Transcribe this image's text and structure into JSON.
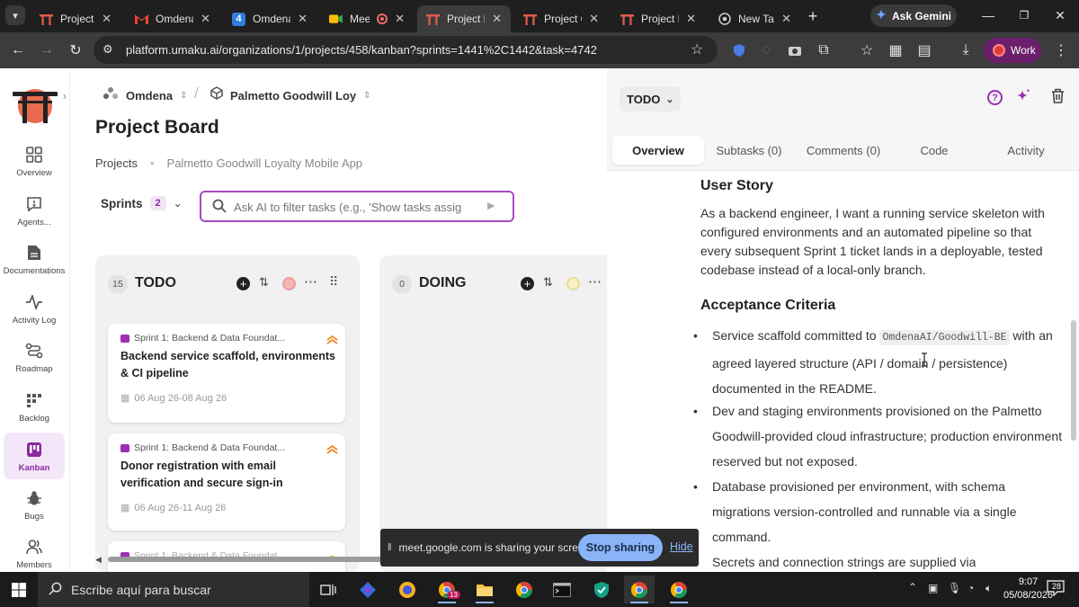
{
  "browser": {
    "tabs": [
      {
        "title": "Project B",
        "icon": "umaku-icon",
        "active": false
      },
      {
        "title": "Omdena",
        "icon": "gmail-icon",
        "active": false
      },
      {
        "title": "Omdena",
        "icon": "app-4-icon",
        "active": false
      },
      {
        "title": "Meet",
        "icon": "meet-icon",
        "active": false
      },
      {
        "title": "Project B",
        "icon": "umaku-icon",
        "active": true
      },
      {
        "title": "Project O",
        "icon": "umaku-icon",
        "active": false
      },
      {
        "title": "Project B",
        "icon": "umaku-icon",
        "active": false
      },
      {
        "title": "New Tab",
        "icon": "chrome-icon",
        "active": false
      }
    ],
    "gemini_label": "Ask Gemini",
    "url": "platform.umaku.ai/organizations/1/projects/458/kanban?sprints=1441%2C1442&task=4742",
    "profile_label": "Work"
  },
  "sidebar": {
    "items": [
      {
        "label": "Overview",
        "icon": "overview-icon",
        "active": false
      },
      {
        "label": "Agents...",
        "icon": "agents-icon",
        "active": false
      },
      {
        "label": "Documentations",
        "icon": "document-icon",
        "active": false
      },
      {
        "label": "Activity Log",
        "icon": "activity-icon",
        "active": false
      },
      {
        "label": "Roadmap",
        "icon": "roadmap-icon",
        "active": false
      },
      {
        "label": "Backlog",
        "icon": "backlog-icon",
        "active": false
      },
      {
        "label": "Kanban",
        "icon": "kanban-icon",
        "active": true
      },
      {
        "label": "Bugs",
        "icon": "bug-icon",
        "active": false
      },
      {
        "label": "Members",
        "icon": "members-icon",
        "active": false
      }
    ]
  },
  "header": {
    "org": "Omdena",
    "project": "Palmetto Goodwill Loy",
    "separator": "/"
  },
  "board": {
    "title": "Project Board",
    "breadcrumb_root": "Projects",
    "breadcrumb_project": "Palmetto Goodwill Loyalty Mobile App",
    "sprints_label": "Sprints",
    "sprints_count": "2",
    "search_placeholder": "Ask AI to filter tasks (e.g., 'Show tasks assig",
    "columns": [
      {
        "name": "TODO",
        "count": "15"
      },
      {
        "name": "DOING",
        "count": "0"
      }
    ],
    "cards": [
      {
        "sprint": "Sprint 1: Backend & Data Foundat...",
        "title": "Backend service scaffold, environments & CI pipeline",
        "dates": "06 Aug 26-08 Aug 26"
      },
      {
        "sprint": "Sprint 1: Backend & Data Foundat...",
        "title": "Donor registration with email verification and secure sign-in",
        "dates": "06 Aug 26-11 Aug 26"
      },
      {
        "sprint": "Sprint 1: Backend & Data Foundat...",
        "title": "",
        "dates": ""
      }
    ]
  },
  "detail": {
    "status": "TODO",
    "tabs": [
      "Overview",
      "Subtasks (0)",
      "Comments (0)",
      "Code",
      "Activity"
    ],
    "user_story_heading": "User Story",
    "user_story": "As a backend engineer, I want a running service skeleton with configured environments and an automated pipeline so that every subsequent Sprint 1 ticket lands in a deployable, tested codebase instead of a local-only branch.",
    "acceptance_heading": "Acceptance Criteria",
    "criteria": [
      {
        "pre": "Service scaffold committed to ",
        "code": "OmdenaAI/Goodwill-BE",
        "post": " with an agreed layered structure (API / domain / persistence) documented in the README."
      },
      {
        "pre": "Dev and staging environments provisioned on the Palmetto Goodwill-provided cloud infrastructure; production environment reserved but not exposed.",
        "code": "",
        "post": ""
      },
      {
        "pre": "Database provisioned per environment, with schema migrations version-controlled and runnable via a single command.",
        "code": "",
        "post": ""
      },
      {
        "pre": "Secrets and connection strings are supplied via",
        "code": "",
        "post": ""
      }
    ]
  },
  "share_bar": {
    "message": "meet.google.com is sharing your screen.",
    "stop_label": "Stop sharing",
    "hide_label": "Hide"
  },
  "taskbar": {
    "search_placeholder": "Escribe aquí para buscar",
    "time": "9:07",
    "date": "05/08/2026",
    "badge_app": "13",
    "notifications": "28"
  },
  "colors": {
    "accent": "#9c2fb3",
    "chrome_dark": "#1f1f1f",
    "gemini_star": "#6ea8ff"
  }
}
